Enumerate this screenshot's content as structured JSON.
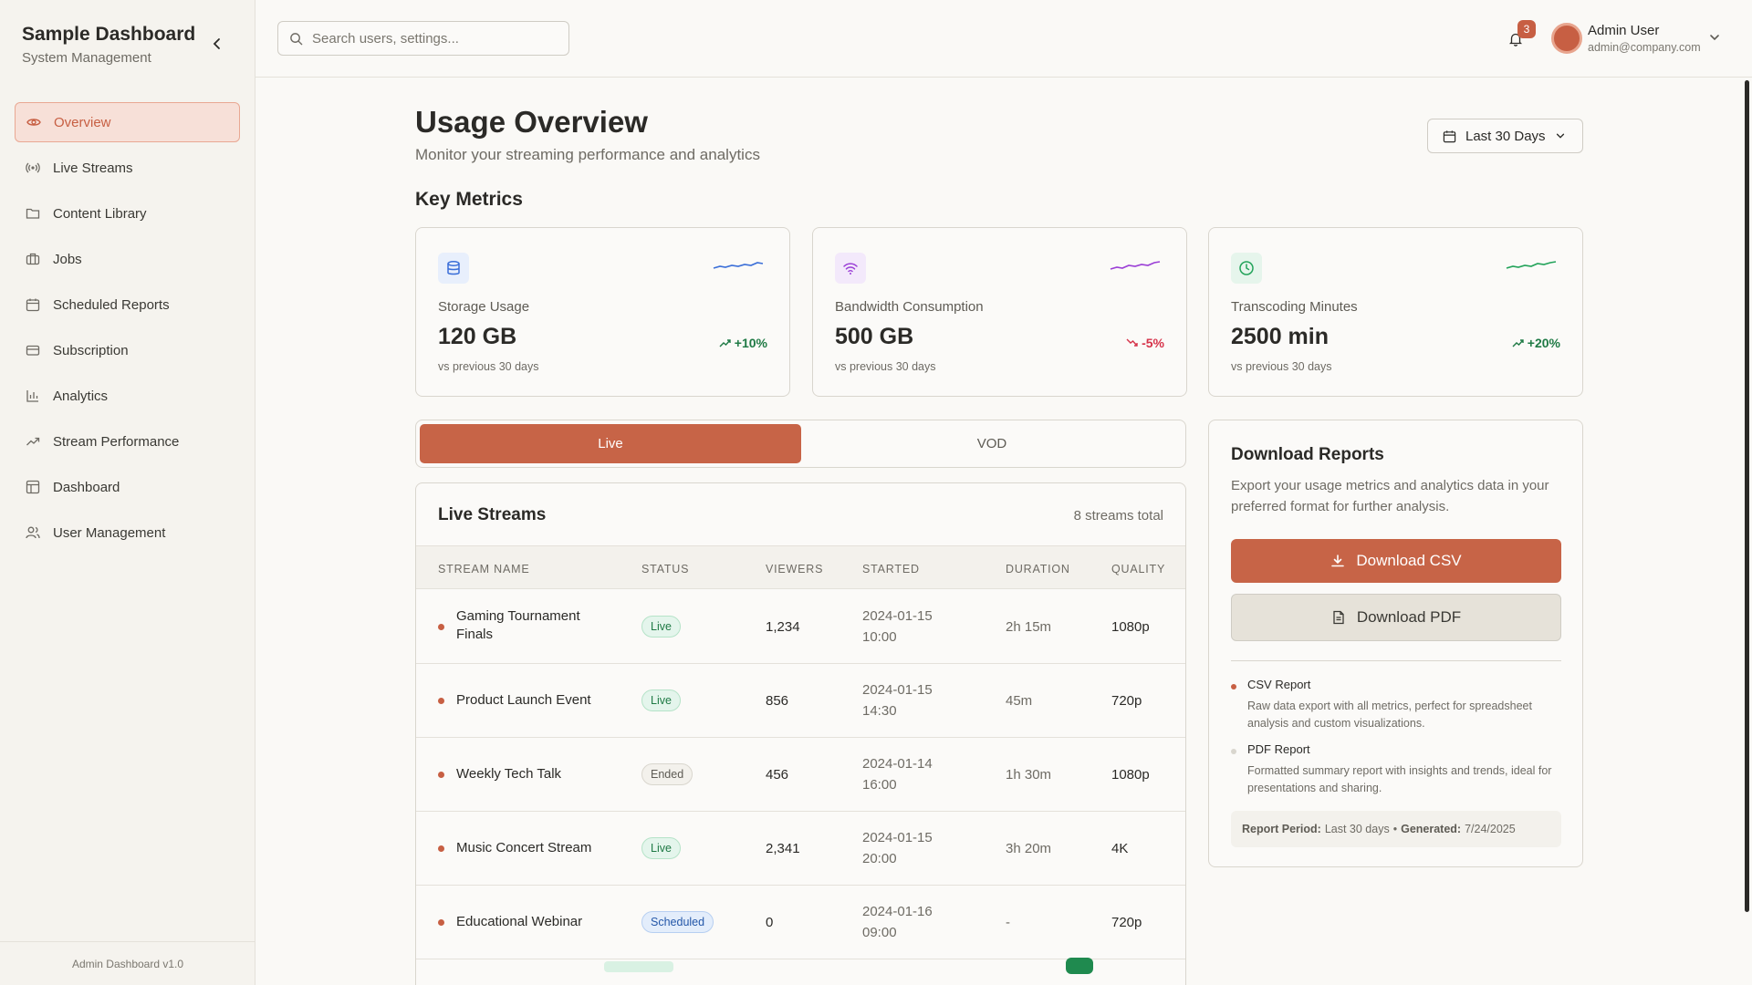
{
  "sidebar": {
    "title": "Sample Dashboard",
    "subtitle": "System Management",
    "items": [
      {
        "label": "Overview",
        "icon": "eye-icon",
        "active": true
      },
      {
        "label": "Live Streams",
        "icon": "broadcast-icon"
      },
      {
        "label": "Content Library",
        "icon": "folder-icon"
      },
      {
        "label": "Jobs",
        "icon": "briefcase-icon"
      },
      {
        "label": "Scheduled Reports",
        "icon": "calendar-icon"
      },
      {
        "label": "Subscription",
        "icon": "credit-card-icon"
      },
      {
        "label": "Analytics",
        "icon": "bar-chart-icon"
      },
      {
        "label": "Stream Performance",
        "icon": "trending-up-icon"
      },
      {
        "label": "Dashboard",
        "icon": "layout-icon"
      },
      {
        "label": "User Management",
        "icon": "users-icon"
      }
    ],
    "footer": "Admin Dashboard v1.0"
  },
  "header": {
    "search_placeholder": "Search users, settings...",
    "notification_count": "3",
    "user_name": "Admin User",
    "user_email": "admin@company.com"
  },
  "page": {
    "title": "Usage Overview",
    "subtitle": "Monitor your streaming performance and analytics",
    "date_range": "Last 30 Days",
    "metrics_title": "Key Metrics"
  },
  "metrics": [
    {
      "label": "Storage Usage",
      "value": "120 GB",
      "change": "+10%",
      "trend": "up",
      "note": "vs previous 30 days",
      "icon": "database-icon",
      "color": "#3b6fd8"
    },
    {
      "label": "Bandwidth Consumption",
      "value": "500 GB",
      "change": "-5%",
      "trend": "down",
      "note": "vs previous 30 days",
      "icon": "wifi-icon",
      "color": "#9b3fd6"
    },
    {
      "label": "Transcoding Minutes",
      "value": "2500 min",
      "change": "+20%",
      "trend": "up",
      "note": "vs previous 30 days",
      "icon": "clock-icon",
      "color": "#23a35a"
    }
  ],
  "tabs": {
    "live": "Live",
    "vod": "VOD"
  },
  "streams": {
    "title": "Live Streams",
    "total": "8 streams total",
    "columns": [
      "STREAM NAME",
      "STATUS",
      "VIEWERS",
      "STARTED",
      "DURATION",
      "QUALITY"
    ],
    "rows": [
      {
        "name_1": "Gaming Tournament",
        "name_2": "Finals",
        "status": "Live",
        "viewers": "1,234",
        "date": "2024-01-15",
        "time": "10:00",
        "duration": "2h 15m",
        "quality": "1080p"
      },
      {
        "name_1": "Product Launch Event",
        "name_2": "",
        "status": "Live",
        "viewers": "856",
        "date": "2024-01-15",
        "time": "14:30",
        "duration": "45m",
        "quality": "720p"
      },
      {
        "name_1": "Weekly Tech Talk",
        "name_2": "",
        "status": "Ended",
        "viewers": "456",
        "date": "2024-01-14",
        "time": "16:00",
        "duration": "1h 30m",
        "quality": "1080p"
      },
      {
        "name_1": "Music Concert Stream",
        "name_2": "",
        "status": "Live",
        "viewers": "2,341",
        "date": "2024-01-15",
        "time": "20:00",
        "duration": "3h 20m",
        "quality": "4K"
      },
      {
        "name_1": "Educational Webinar",
        "name_2": "",
        "status": "Scheduled",
        "viewers": "0",
        "date": "2024-01-16",
        "time": "09:00",
        "duration": "-",
        "quality": "720p"
      }
    ]
  },
  "reports": {
    "title": "Download Reports",
    "description": "Export your usage metrics and analytics data in your preferred format for further analysis.",
    "csv_button": "Download CSV",
    "pdf_button": "Download PDF",
    "csv_title": "CSV Report",
    "csv_desc": "Raw data export with all metrics, perfect for spreadsheet analysis and custom visualizations.",
    "pdf_title": "PDF Report",
    "pdf_desc": "Formatted summary report with insights and trends, ideal for presentations and sharing.",
    "period_label": "Report Period:",
    "period_value": "Last 30 days",
    "separator": "•",
    "generated_label": "Generated:",
    "generated_value": "7/24/2025"
  },
  "colors": {
    "accent": "#c76447",
    "accent_light": "#f7e0d8",
    "success": "#1f7a45",
    "danger": "#d6334a"
  }
}
